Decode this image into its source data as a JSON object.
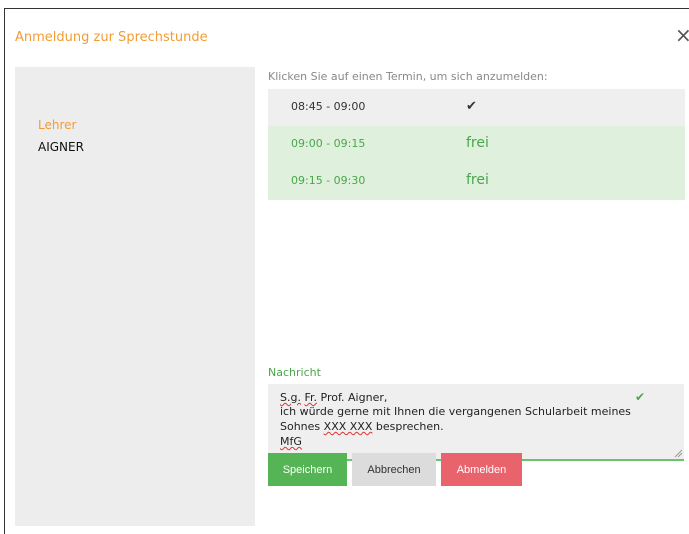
{
  "dialog": {
    "title": "Anmeldung zur Sprechstunde",
    "close_symbol": "×"
  },
  "teacher": {
    "label": "Lehrer",
    "name": "AIGNER"
  },
  "schedule": {
    "instruction": "Klicken Sie auf einen Termin, um sich anzumelden:",
    "slots": [
      {
        "time": "08:45 - 09:00",
        "state": "✔",
        "status": "booked"
      },
      {
        "time": "09:00 - 09:15",
        "state": "frei",
        "status": "free"
      },
      {
        "time": "09:15 - 09:30",
        "state": "frei",
        "status": "free"
      }
    ]
  },
  "message": {
    "label": "Nachricht",
    "line1_a": "S.g.",
    "line1_b": "Fr.",
    "line1_c": "Prof. Aigner,",
    "line2": "ich würde gerne mit Ihnen die vergangenen Schularbeit meines",
    "line3_a": "Sohnes ",
    "line3_b": "XXX XXX",
    "line3_c": " besprechen.",
    "line4": "MfG"
  },
  "buttons": {
    "save": "Speichern",
    "cancel": "Abbrechen",
    "unregister": "Abmelden"
  },
  "colors": {
    "accent_orange": "#f39c33",
    "success_green": "#55b555",
    "free_slot_bg": "#dff1dd",
    "danger_red": "#e8636b"
  },
  "icons": {
    "close": "close-icon",
    "check": "checkmark-icon",
    "resize": "resize-handle-icon"
  }
}
